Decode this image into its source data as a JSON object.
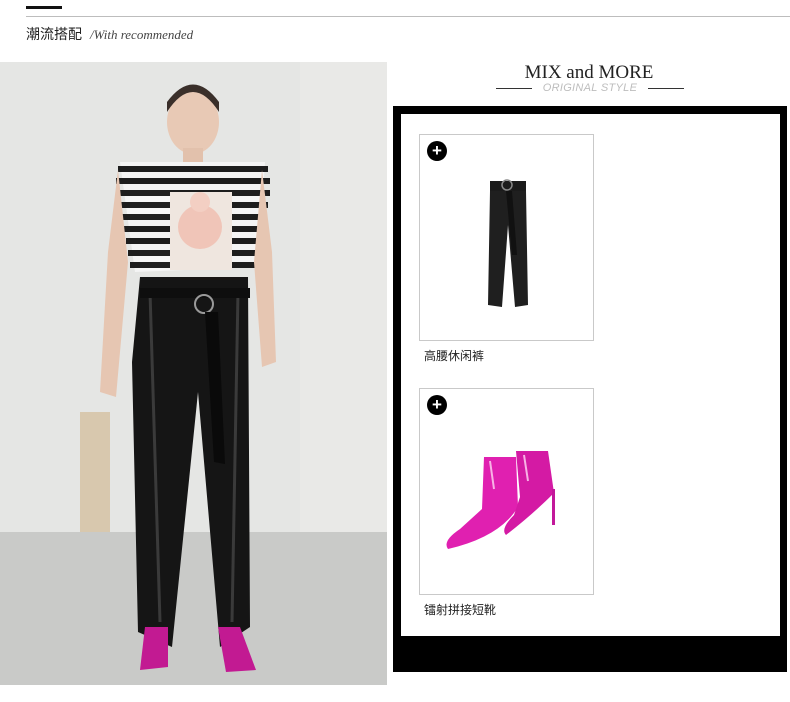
{
  "header": {
    "title": "潮流搭配",
    "subtitle": "/With recommended"
  },
  "mix": {
    "title": "MIX and MORE",
    "subtitle": "ORIGINAL STYLE"
  },
  "products": [
    {
      "name": "高腰休闲裤",
      "icon": "plus-circle-icon",
      "image": "black-high-waist-trousers"
    },
    {
      "name": "镭射拼接短靴",
      "icon": "plus-circle-icon",
      "image": "pink-metallic-ankle-boots"
    }
  ],
  "colors": {
    "panel_border": "#000000",
    "boot_pink": "#e020b0",
    "rule": "#bdbdbd"
  }
}
